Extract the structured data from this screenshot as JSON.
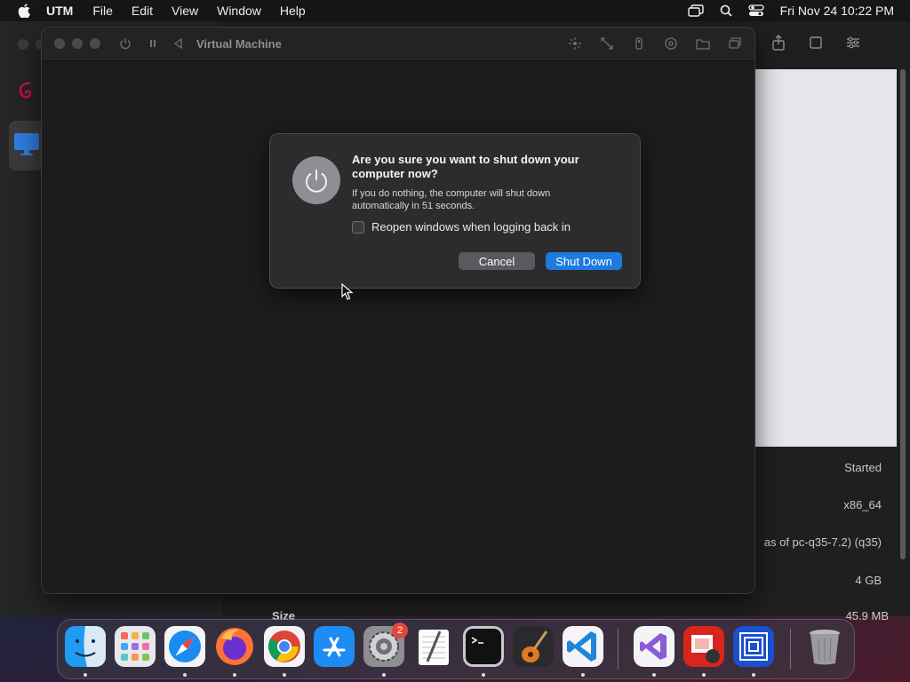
{
  "menubar": {
    "app_name": "UTM",
    "items": [
      "File",
      "Edit",
      "View",
      "Window",
      "Help"
    ],
    "clock": "Fri Nov 24  10:22 PM"
  },
  "vm_window": {
    "title": "Virtual Machine"
  },
  "dialog": {
    "title": "Are you sure you want to shut down your computer now?",
    "message": "If you do nothing, the computer will shut down automatically in 51 seconds.",
    "checkbox_label": "Reopen windows when logging back in",
    "checkbox_checked": false,
    "cancel_label": "Cancel",
    "confirm_label": "Shut Down"
  },
  "info_panel": {
    "status": "Started",
    "architecture": "x86_64",
    "machine": "as of pc-q35-7.2) (q35)",
    "memory": "4 GB",
    "size_label": "Size",
    "size_value": "45.9 MB"
  },
  "dock": {
    "apps": [
      {
        "name": "Finder",
        "icon": "finder-icon"
      },
      {
        "name": "Launchpad",
        "icon": "launchpad-icon"
      },
      {
        "name": "Safari",
        "icon": "safari-icon"
      },
      {
        "name": "Firefox",
        "icon": "firefox-icon"
      },
      {
        "name": "Chrome",
        "icon": "chrome-icon"
      },
      {
        "name": "App Store",
        "icon": "app-store-icon"
      },
      {
        "name": "System Settings",
        "icon": "system-settings-icon",
        "badge": "2"
      },
      {
        "name": "TextEdit",
        "icon": "textedit-icon"
      },
      {
        "name": "Terminal",
        "icon": "terminal-icon"
      },
      {
        "name": "GarageBand",
        "icon": "garageband-icon"
      },
      {
        "name": "Visual Studio Code",
        "icon": "vscode-icon"
      },
      {
        "name": "Visual Studio",
        "icon": "visual-studio-icon"
      },
      {
        "name": "Photo Booth",
        "icon": "photo-booth-icon"
      },
      {
        "name": "UTM",
        "icon": "utm-icon"
      },
      {
        "name": "Trash",
        "icon": "trash-icon"
      }
    ]
  },
  "colors": {
    "accent": "#1f7ae0",
    "dialog_bg": "#2c2c2e",
    "badge": "#e8443a"
  }
}
